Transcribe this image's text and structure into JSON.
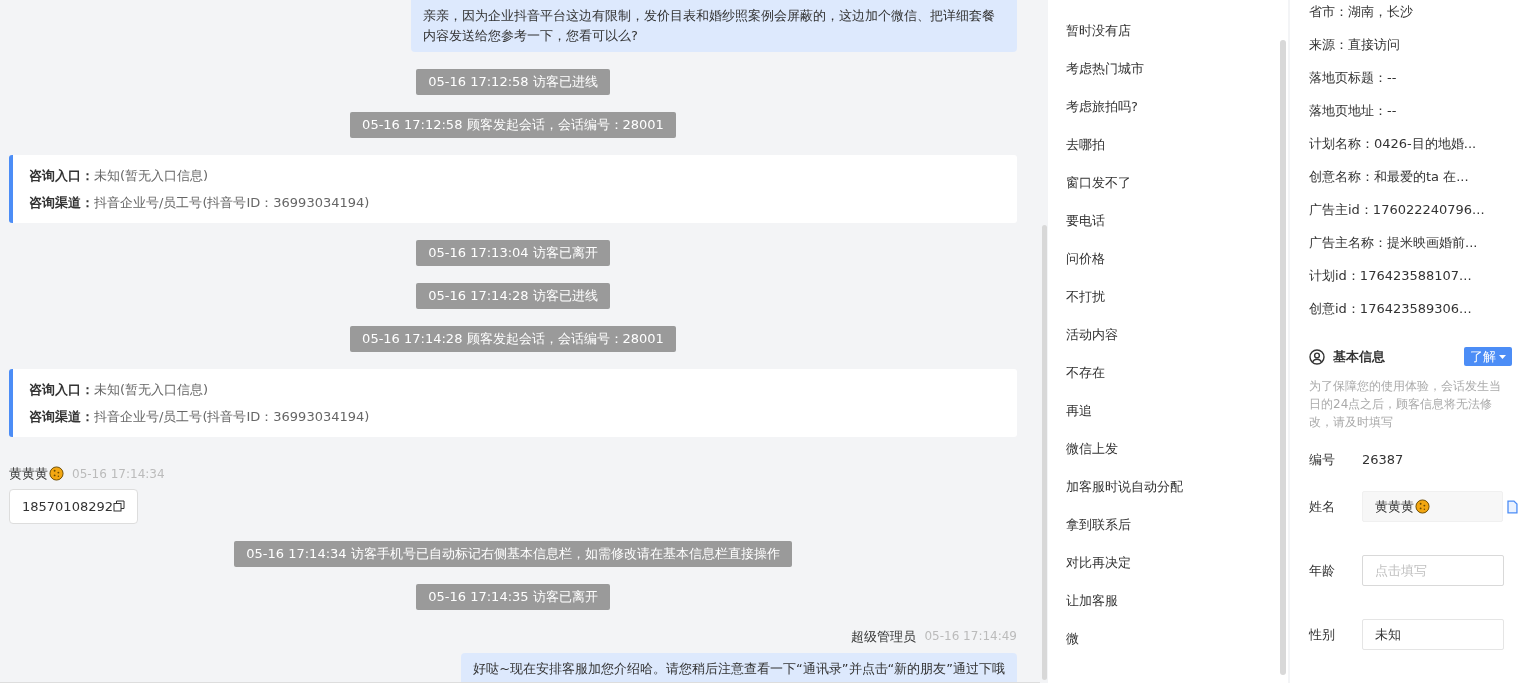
{
  "chat": {
    "messages": [
      {
        "kind": "agent",
        "text": "亲亲，因为企业抖音平台这边有限制，发价目表和婚纱照案例会屏蔽的，这边加个微信、把详细套餐内容发送给您参考一下，您看可以么?"
      },
      {
        "kind": "system",
        "time": "05-16 17:12:58",
        "text": "访客已进线"
      },
      {
        "kind": "system",
        "time": "05-16 17:12:58",
        "text": "顾客发起会话，会话编号：28001"
      },
      {
        "kind": "source",
        "rows": [
          {
            "label": "咨询入口：",
            "value": "未知(暂无入口信息)"
          },
          {
            "label": "咨询渠道：",
            "value": "抖音企业号/员工号(抖音号ID：36993034194)"
          }
        ]
      },
      {
        "kind": "system",
        "time": "05-16 17:13:04",
        "text": "访客已离开"
      },
      {
        "kind": "system",
        "time": "05-16 17:14:28",
        "text": "访客已进线"
      },
      {
        "kind": "system",
        "time": "05-16 17:14:28",
        "text": "顾客发起会话，会话编号：28001"
      },
      {
        "kind": "source",
        "rows": [
          {
            "label": "咨询入口：",
            "value": "未知(暂无入口信息)"
          },
          {
            "label": "咨询渠道：",
            "value": "抖音企业号/员工号(抖音号ID：36993034194)"
          }
        ]
      },
      {
        "kind": "visitor",
        "sender": "黄黄黄",
        "time": "05-16 17:14:34",
        "text": "18570108292"
      },
      {
        "kind": "system",
        "time": "05-16 17:14:34",
        "text": "访客手机号已自动标记右侧基本信息栏，如需修改请在基本信息栏直接操作"
      },
      {
        "kind": "system",
        "time": "05-16 17:14:35",
        "text": "访客已离开"
      },
      {
        "kind": "agent",
        "sender": "超级管理员",
        "time": "05-16 17:14:49",
        "text": "好哒~现在安排客服加您介绍哈。请您稍后注意查看一下“通讯录”并点击“新的朋友”通过下哦"
      }
    ]
  },
  "quick_replies": [
    "暂时没有店",
    "考虑热门城市",
    "考虑旅拍吗?",
    "去哪拍",
    "窗口发不了",
    "要电话",
    "问价格",
    "不打扰",
    "活动内容",
    "不存在",
    "再追",
    "微信上发",
    "加客服时说自动分配",
    "拿到联系后",
    "对比再决定",
    "让加客服",
    "微"
  ],
  "visit_info": [
    "省市：湖南，长沙",
    "来源：直接访问",
    "落地页标题：--",
    "落地页地址：--",
    "计划名称：0426-目的地婚...",
    "创意名称：和最爱的ta 在...",
    "广告主id：176022240796...",
    "广告主名称：提米映画婚前...",
    "计划id：176423588107...",
    "创意id：176423589306..."
  ],
  "basic_info": {
    "title": "基本信息",
    "learn_button": "了解",
    "note": "为了保障您的使用体验，会话发生当日的24点之后，顾客信息将无法修改，请及时填写",
    "fields": [
      {
        "kind": "text",
        "label": "编号",
        "value": "26387"
      },
      {
        "kind": "name",
        "label": "姓名",
        "value": "黄黄黄"
      },
      {
        "kind": "input",
        "label": "年龄",
        "placeholder": "点击填写"
      },
      {
        "kind": "select",
        "label": "性别",
        "value": "未知"
      }
    ]
  }
}
